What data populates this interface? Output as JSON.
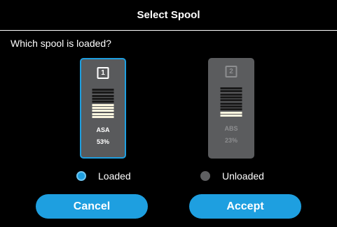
{
  "header": {
    "title": "Select Spool"
  },
  "prompt": "Which spool is loaded?",
  "spools": [
    {
      "number": "1",
      "material": "ASA",
      "percent": "53%",
      "fill_fraction": 0.53,
      "selected": true
    },
    {
      "number": "2",
      "material": "ABS",
      "percent": "23%",
      "fill_fraction": 0.23,
      "selected": false
    }
  ],
  "options": {
    "loaded": {
      "label": "Loaded",
      "checked": true
    },
    "unloaded": {
      "label": "Unloaded",
      "checked": false
    }
  },
  "buttons": {
    "cancel": "Cancel",
    "accept": "Accept"
  },
  "colors": {
    "accent": "#1e9fe0",
    "card": "#595a5c",
    "filament": "#fbf6df"
  },
  "icons": {
    "radio_checked": "radio-checked-icon",
    "radio_unchecked": "radio-unchecked-icon"
  }
}
